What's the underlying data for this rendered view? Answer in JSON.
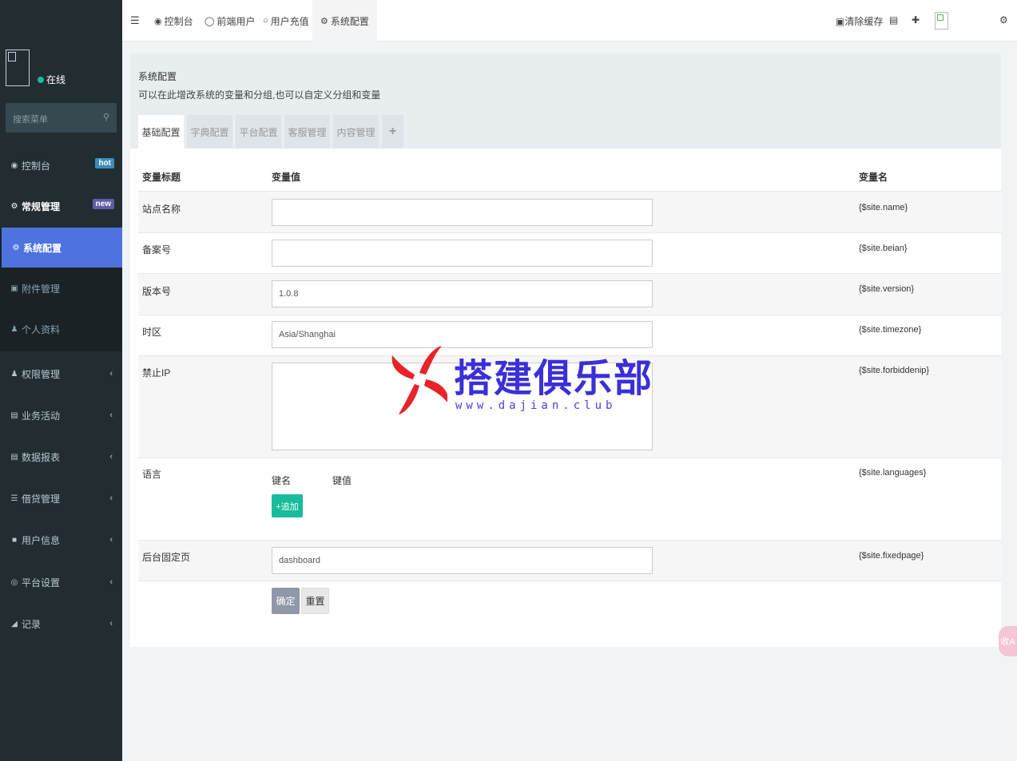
{
  "sidebar": {
    "status": "在线",
    "search_placeholder": "搜索菜单",
    "items": [
      {
        "label": "控制台",
        "badge": "hot"
      },
      {
        "label": "常规管理",
        "badge": "new"
      },
      {
        "label": "系统配置"
      },
      {
        "label": "附件管理"
      },
      {
        "label": "个人资料"
      },
      {
        "label": "权限管理"
      },
      {
        "label": "业务活动"
      },
      {
        "label": "数据报表"
      },
      {
        "label": "借贷管理"
      },
      {
        "label": "用户信息"
      },
      {
        "label": "平台设置"
      },
      {
        "label": "记录"
      }
    ]
  },
  "topbar": {
    "tabs": [
      {
        "label": "控制台"
      },
      {
        "label": "前端用户"
      },
      {
        "label": "用户充值"
      },
      {
        "label": "系统配置"
      }
    ],
    "clear_cache": "清除缓存"
  },
  "panel": {
    "title": "系统配置",
    "description": "可以在此增改系统的变量和分组,也可以自定义分组和变量",
    "tabs": [
      "基础配置",
      "字典配置",
      "平台配置",
      "客服管理",
      "内容管理"
    ],
    "add_tab": "+",
    "headers": {
      "title": "变量标题",
      "value": "变量值",
      "name": "变量名"
    },
    "rows": [
      {
        "label": "站点名称",
        "value": "",
        "var": "{$site.name}"
      },
      {
        "label": "备案号",
        "value": "",
        "var": "{$site.beian}"
      },
      {
        "label": "版本号",
        "value": "1.0.8",
        "var": "{$site.version}"
      },
      {
        "label": "时区",
        "value": "Asia/Shanghai",
        "var": "{$site.timezone}"
      },
      {
        "label": "禁止IP",
        "value": "",
        "var": "{$site.forbiddenip}"
      },
      {
        "label": "语言",
        "var": "{$site.languages}",
        "key_header": "键名",
        "value_header": "键值",
        "add_button": "+追加"
      },
      {
        "label": "后台固定页",
        "value": "dashboard",
        "var": "{$site.fixedpage}"
      }
    ],
    "submit": "确定",
    "reset": "重置"
  },
  "watermark": {
    "text": "搭建俱乐部",
    "url": "www.dajian.club"
  },
  "side_bubble": "收A"
}
